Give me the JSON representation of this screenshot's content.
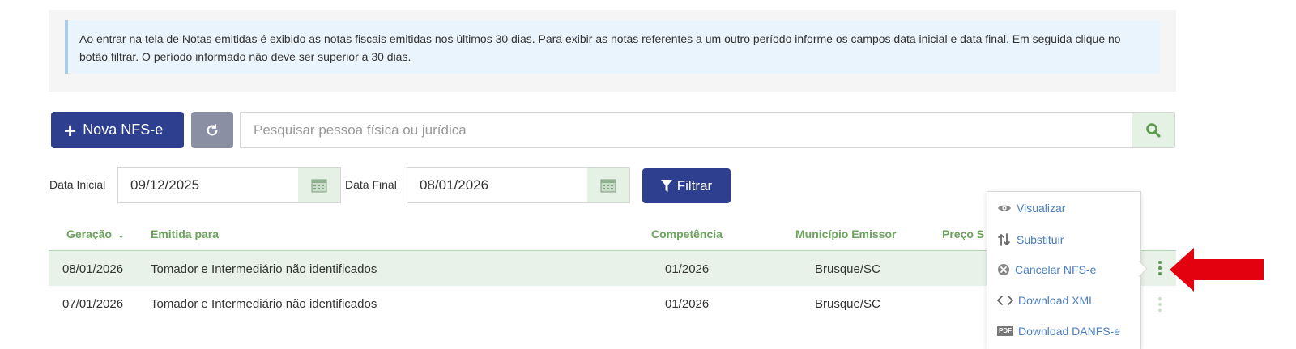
{
  "info": {
    "text": "Ao entrar na tela de Notas emitidas é exibido as notas fiscais emitidas nos últimos 30 dias. Para exibir as notas referentes a um outro período informe os campos data inicial e data final. Em seguida clique no botão filtrar. O período informado não deve ser superior a 30 dias."
  },
  "toolbar": {
    "new_label": "Nova NFS-e",
    "search_placeholder": "Pesquisar pessoa física ou jurídica"
  },
  "filters": {
    "start_label": "Data Inicial",
    "start_value": "09/12/2025",
    "end_label": "Data Final",
    "end_value": "08/01/2026",
    "filter_label": "Filtrar"
  },
  "table": {
    "headers": {
      "geracao": "Geração",
      "emitida": "Emitida para",
      "competencia": "Competência",
      "municipio": "Município Emissor",
      "preco": "Preço S"
    },
    "rows": [
      {
        "geracao": "08/01/2026",
        "emitida": "Tomador e Intermediário não identificados",
        "competencia": "01/2026",
        "municipio": "Brusque/SC"
      },
      {
        "geracao": "07/01/2026",
        "emitida": "Tomador e Intermediário não identificados",
        "competencia": "01/2026",
        "municipio": "Brusque/SC"
      }
    ]
  },
  "menu": {
    "items": [
      {
        "label": "Visualizar",
        "icon": "eye-icon"
      },
      {
        "label": "Substituir",
        "icon": "swap-arrows-icon"
      },
      {
        "label": "Cancelar NFS-e",
        "icon": "cancel-circle-icon"
      },
      {
        "label": "Download XML",
        "icon": "code-icon"
      },
      {
        "label": "Download DANFS-e",
        "icon": "pdf-icon"
      }
    ],
    "pdf_icon_text": "PDF"
  },
  "colors": {
    "primary": "#2d3f8e",
    "accent_green": "#6aa35b",
    "link_blue": "#4a7fc1",
    "highlight_arrow": "#e3000f",
    "info_bg": "#eaf4fd"
  }
}
